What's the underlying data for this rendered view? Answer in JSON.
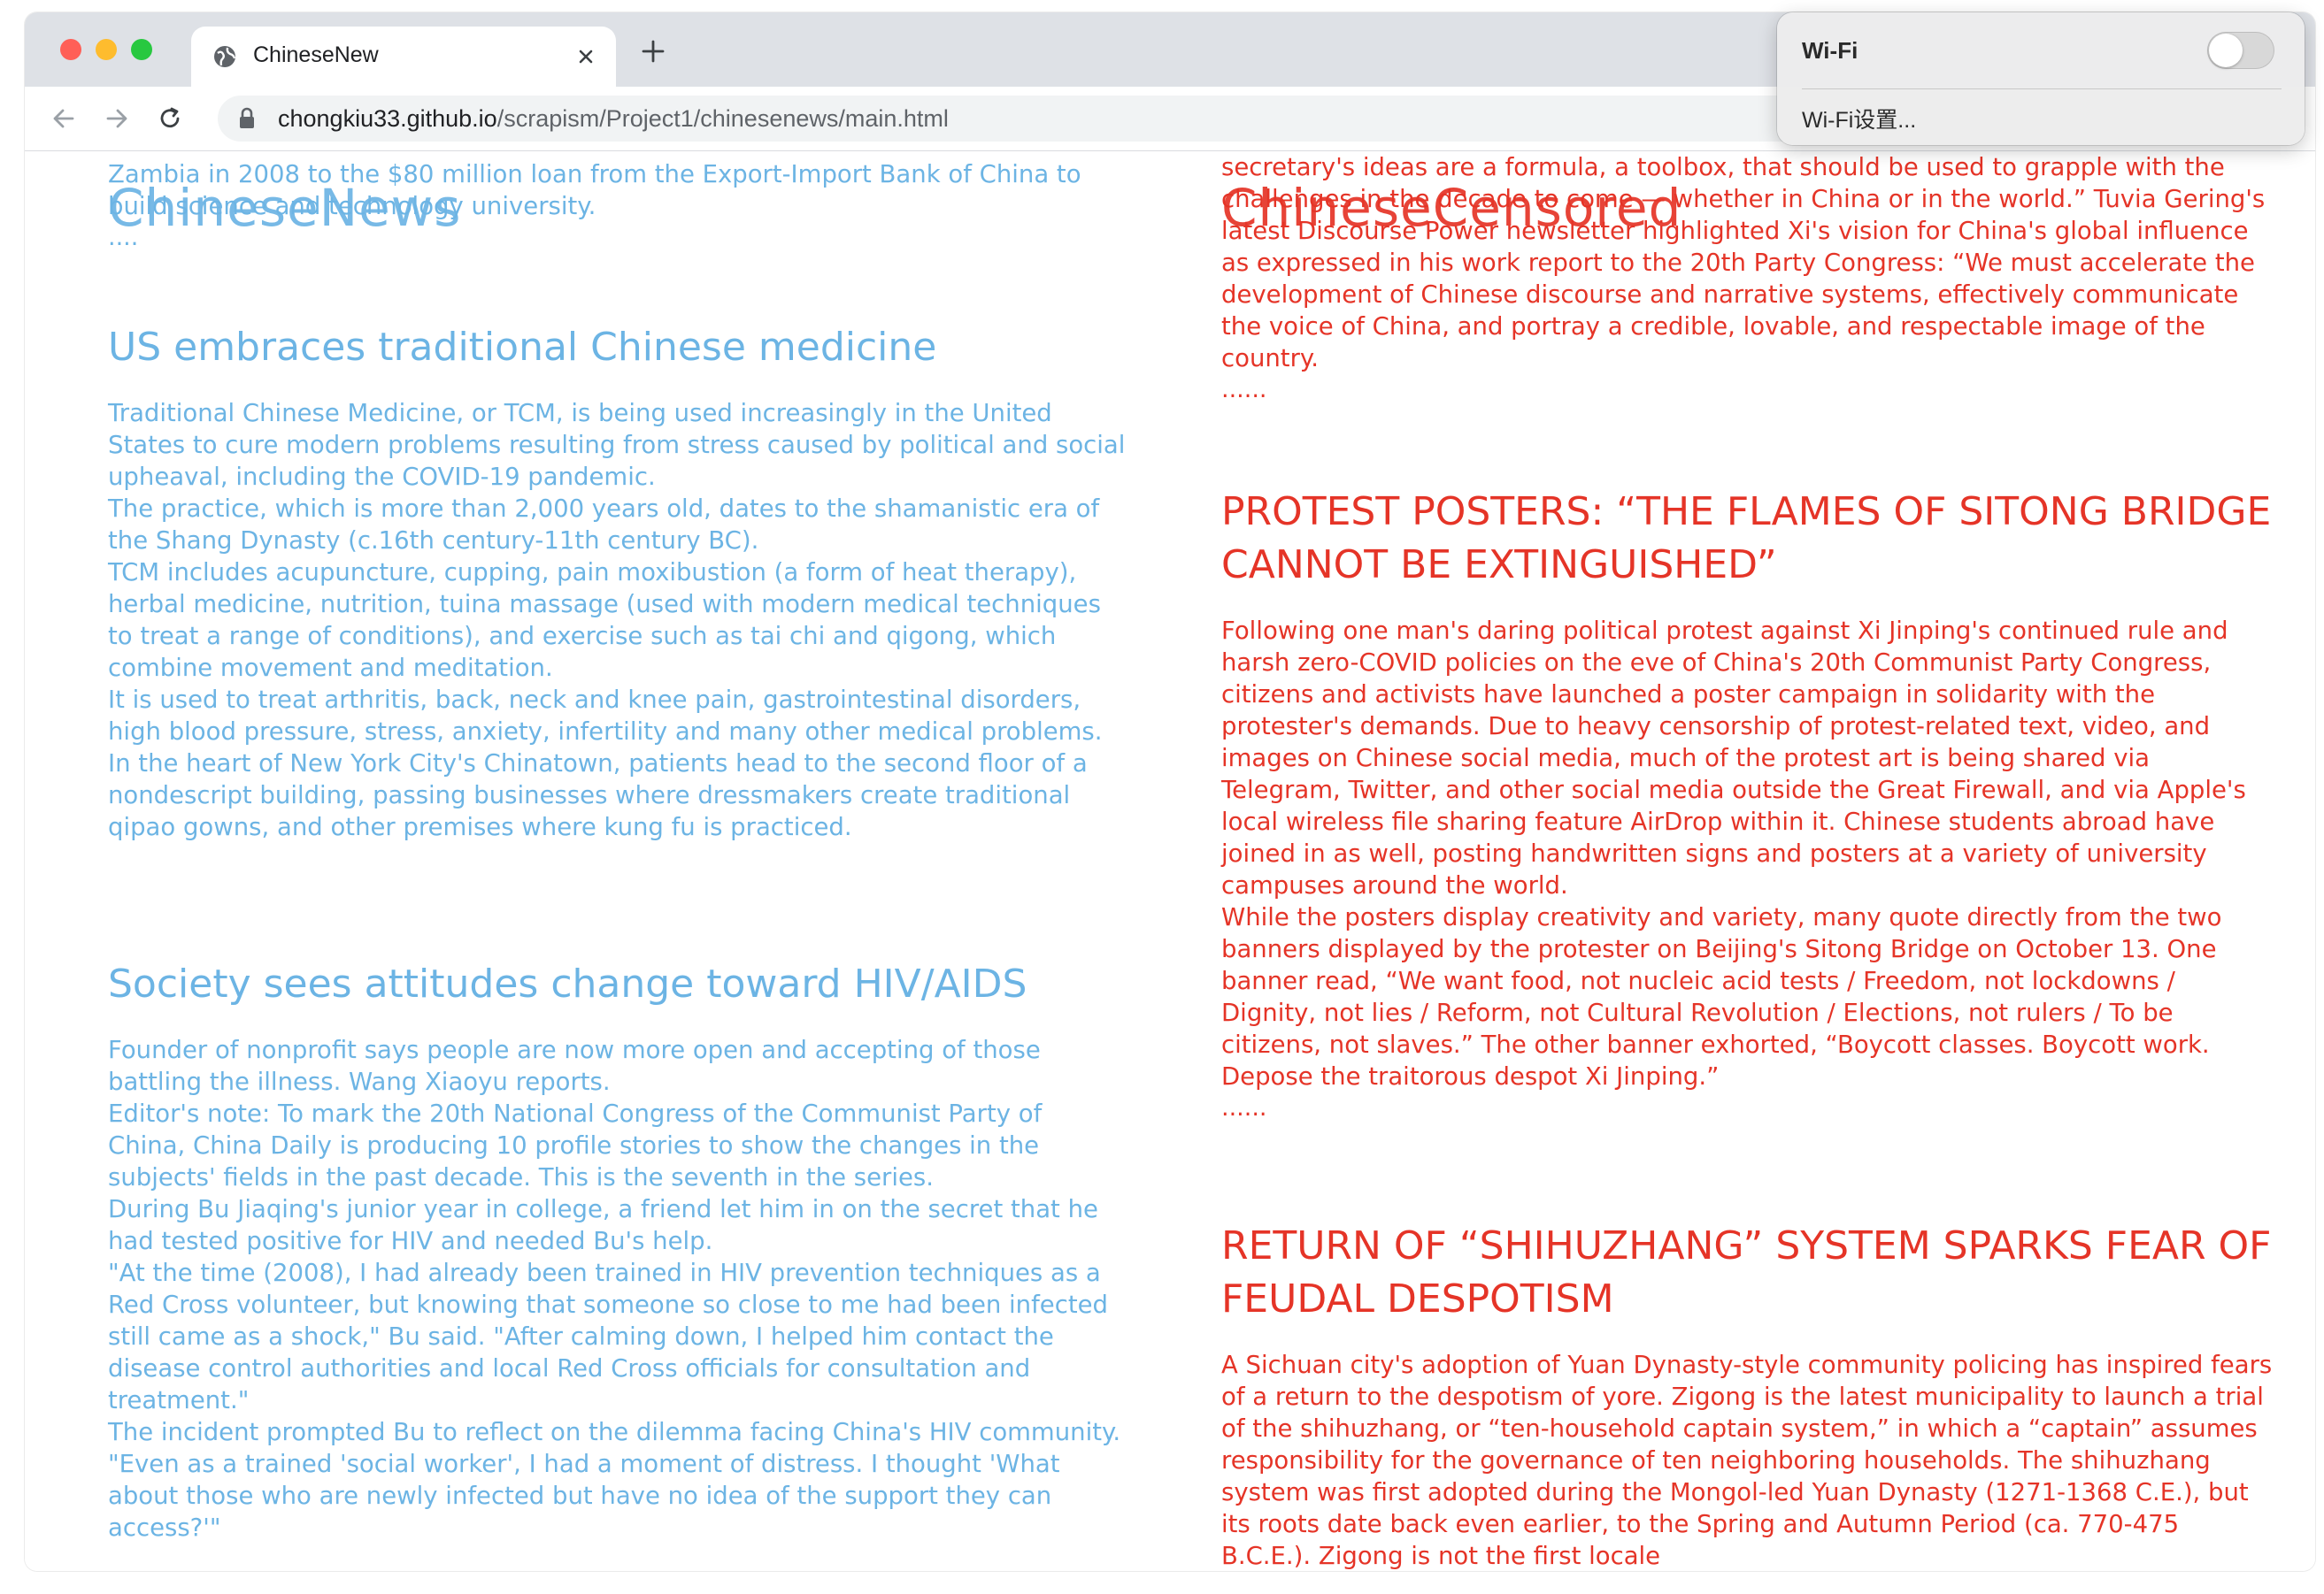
{
  "browser": {
    "tab_title": "ChineseNew",
    "url_host": "chongkiu33.github.io",
    "url_path": "/scrapism/Project1/chinesenews/main.html"
  },
  "wifi_menu": {
    "title": "Wi-Fi",
    "toggle_on": false,
    "settings_label": "Wi-Fi设置..."
  },
  "colors": {
    "left_text": "#6cb4e4",
    "right_text": "#e53427"
  },
  "left": {
    "logo": "ChineseNews",
    "intro_paragraphs": [
      "Zambia in 2008 to the $80 million loan from the Export-Import Bank of China to build science and technology university."
    ],
    "intro_dots": "....",
    "articles": [
      {
        "headline": "US embraces traditional Chinese medicine",
        "paragraphs": [
          "Traditional Chinese Medicine, or TCM, is being used increasingly in the United States to cure modern problems resulting from stress caused by political and social upheaval, including the COVID-19 pandemic.",
          "The practice, which is more than 2,000 years old, dates to the shamanistic era of the Shang Dynasty (c.16th century-11th century BC).",
          "TCM includes acupuncture, cupping, pain moxibustion (a form of heat therapy), herbal medicine, nutrition, tuina massage (used with modern medical techniques to treat a range of conditions), and exercise such as tai chi and qigong, which combine movement and meditation.",
          "It is used to treat arthritis, back, neck and knee pain, gastrointestinal disorders, high blood pressure, stress, anxiety, infertility and many other medical problems.",
          "In the heart of New York City's Chinatown, patients head to the second floor of a nondescript building, passing businesses where dressmakers create traditional qipao gowns, and other premises where kung fu is practiced."
        ]
      },
      {
        "headline": "Society sees attitudes change toward HIV/AIDS",
        "paragraphs": [
          "Founder of nonprofit says people are now more open and accepting of those battling the illness. Wang Xiaoyu reports.",
          "Editor's note: To mark the 20th National Congress of the Communist Party of China, China Daily is producing 10 profile stories to show the changes in the subjects' fields in the past decade. This is the seventh in the series.",
          "During Bu Jiaqing's junior year in college, a friend let him in on the secret that he had tested positive for HIV and needed Bu's help.",
          "\"At the time (2008), I had already been trained in HIV prevention techniques as a Red Cross volunteer, but knowing that someone so close to me had been infected still came as a shock,\" Bu said. \"After calming down, I helped him contact the disease control authorities and local Red Cross officials for consultation and treatment.\"",
          "The incident prompted Bu to reflect on the dilemma facing China's HIV community. \"Even as a trained 'social worker', I had a moment of distress. I thought 'What about those who are newly infected but have no idea of the support they can access?'\""
        ]
      }
    ]
  },
  "right": {
    "logo": "ChineseCensored",
    "intro_paragraphs": [
      "secretary's ideas are a formula, a toolbox, that should be used to grapple with the challenges in the decade to come — whether in China or in the world.” Tuvia Gering's latest Discourse Power newsletter highlighted Xi's vision for China's global influence as expressed in his work report to the 20th Party Congress: “We must accelerate the development of Chinese discourse and narrative systems, effectively communicate the voice of China, and portray a credible, lovable, and respectable image of the country."
    ],
    "intro_dots": "......",
    "articles": [
      {
        "headline": "PROTEST POSTERS: “THE FLAMES OF SITONG BRIDGE CANNOT BE EXTINGUISHED”",
        "paragraphs": [
          "Following one man's daring political protest against Xi Jinping's continued rule and harsh zero-COVID policies on the eve of China's 20th Communist Party Congress, citizens and activists have launched a poster campaign in solidarity with the protester's demands. Due to heavy censorship of protest-related text, video, and images on Chinese social media, much of the protest art is being shared via Telegram, Twitter, and other social media outside the Great Firewall, and via Apple's local wireless file sharing feature AirDrop within it. Chinese students abroad have joined in as well, posting handwritten signs and posters at a variety of university campuses around the world.",
          "While the posters display creativity and variety, many quote directly from the two banners displayed by the protester on Beijing's Sitong Bridge on October 13. One banner read, “We want food, not nucleic acid tests / Freedom, not lockdowns / Dignity, not lies / Reform, not Cultural Revolution / Elections, not rulers / To be citizens, not slaves.” The other banner exhorted, “Boycott classes. Boycott work. Depose the traitorous despot Xi Jinping.”"
        ],
        "dots": "......"
      },
      {
        "headline": "RETURN OF “SHIHUZHANG” SYSTEM SPARKS FEAR OF FEUDAL DESPOTISM",
        "paragraphs": [
          "A Sichuan city's adoption of Yuan Dynasty-style community policing has inspired fears of a return to the despotism of yore. Zigong is the latest municipality to launch a trial of the shihuzhang, or “ten-household captain system,” in which a “captain” assumes responsibility for the governance of ten neighboring households. The shihuzhang system was first adopted during the Mongol-led Yuan Dynasty (1271-1368 C.E.), but its roots date back even earlier, to the Spring and Autumn Period (ca. 770-475 B.C.E.). Zigong is not the first locale"
        ]
      }
    ]
  }
}
